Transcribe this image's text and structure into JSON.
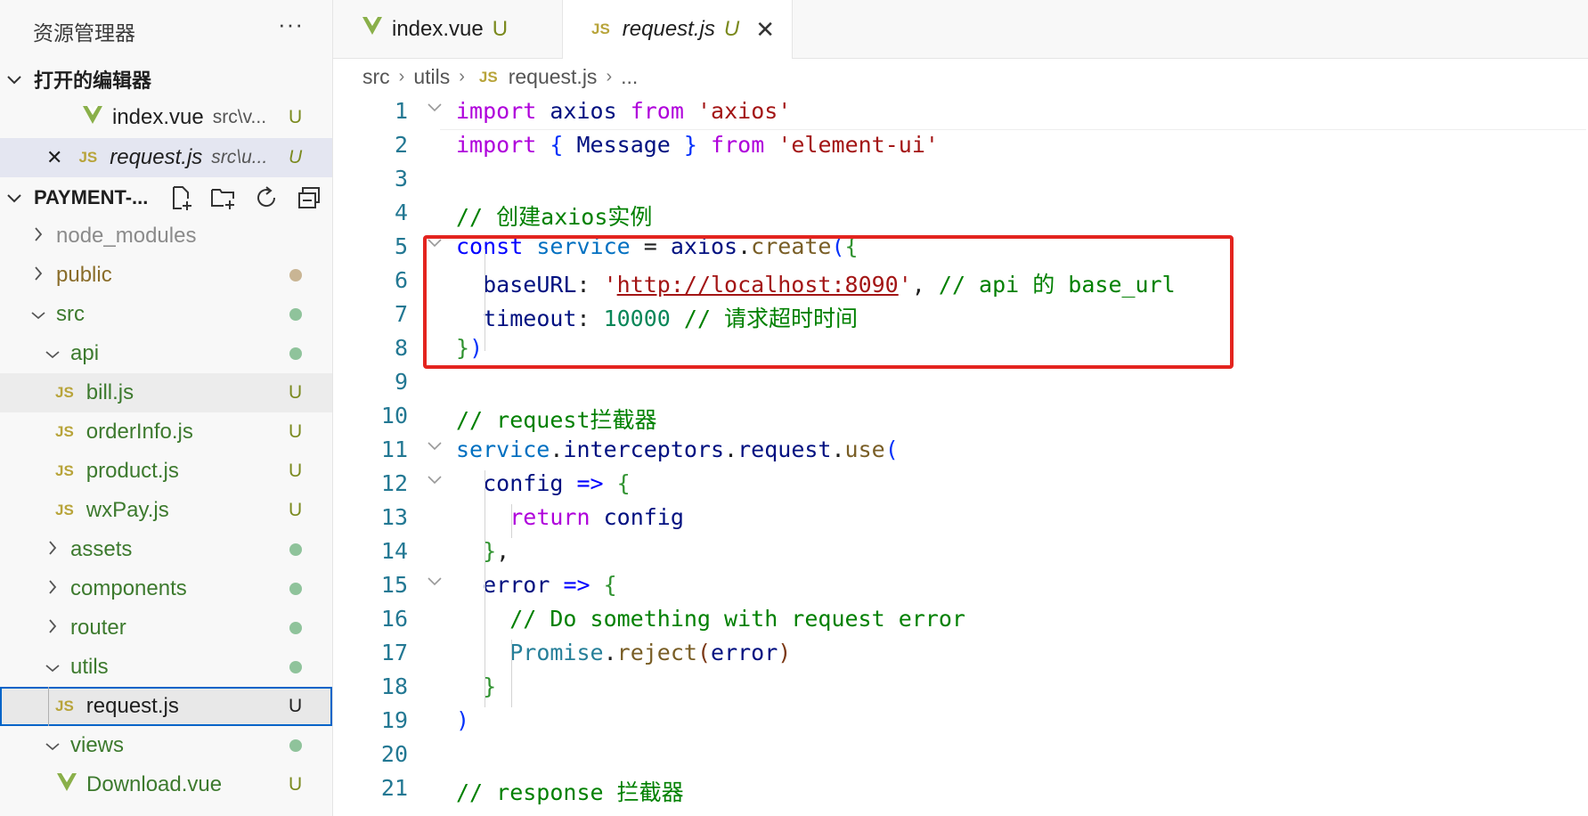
{
  "sidebar": {
    "title": "资源管理器",
    "more": "···",
    "open_editors": {
      "header": "打开的编辑器",
      "items": [
        {
          "label": "index.vue",
          "desc": "src\\v...",
          "status": "U"
        },
        {
          "label": "request.js",
          "desc": "src\\u...",
          "status": "U",
          "close": "✕"
        }
      ]
    },
    "project": {
      "header": "PAYMENT-...",
      "tree": [
        {
          "label": "node_modules"
        },
        {
          "label": "public"
        },
        {
          "label": "src"
        },
        {
          "label": "api"
        },
        {
          "label": "bill.js",
          "status": "U"
        },
        {
          "label": "orderInfo.js",
          "status": "U"
        },
        {
          "label": "product.js",
          "status": "U"
        },
        {
          "label": "wxPay.js",
          "status": "U"
        },
        {
          "label": "assets"
        },
        {
          "label": "components"
        },
        {
          "label": "router"
        },
        {
          "label": "utils"
        },
        {
          "label": "request.js",
          "status": "U"
        },
        {
          "label": "views"
        },
        {
          "label": "Download.vue",
          "status": "U"
        }
      ]
    },
    "js_icon": "JS"
  },
  "tabs": [
    {
      "label": "index.vue",
      "status": "U"
    },
    {
      "label": "request.js",
      "status": "U",
      "close": "✕"
    }
  ],
  "breadcrumb": {
    "parts": [
      "src",
      "utils",
      "request.js",
      "..."
    ],
    "separator": "›"
  },
  "editor": {
    "line_numbers": [
      "1",
      "2",
      "3",
      "4",
      "5",
      "6",
      "7",
      "8",
      "9",
      "10",
      "11",
      "12",
      "13",
      "14",
      "15",
      "16",
      "17",
      "18",
      "19",
      "20",
      "21"
    ],
    "lines": [
      "import axios from 'axios'",
      "import { Message } from 'element-ui'",
      "",
      "// 创建axios实例",
      "const service = axios.create({",
      "  baseURL: 'http://localhost:8090', // api 的 base_url",
      "  timeout: 10000 // 请求超时时间",
      "})",
      "",
      "// request拦截器",
      "service.interceptors.request.use(",
      "  config => {",
      "    return config",
      "  },",
      "  error => {",
      "    // Do something with request error",
      "    Promise.reject(error)",
      "  }",
      ")",
      "",
      "// response 拦截器"
    ]
  },
  "colors": {
    "annotation_box": "#e3241f",
    "status_untracked": "#7b8a1f",
    "dot_green": "#8fc39b",
    "dot_tan": "#c9b594",
    "selection_outline": "#0064c8"
  }
}
